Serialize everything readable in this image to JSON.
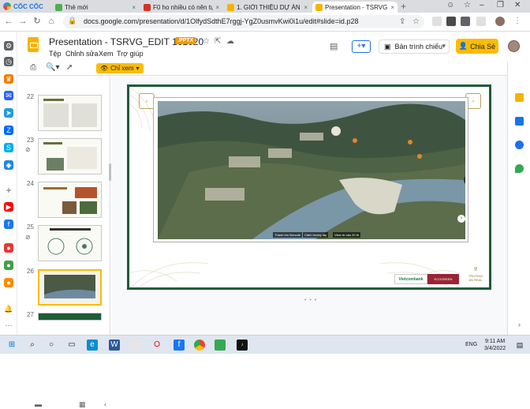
{
  "browser": {
    "name": "CỐC CỐC",
    "tabs": [
      {
        "label": "Thẻ mới",
        "fav_color": "#4caf50"
      },
      {
        "label": "F0 ho nhiều có nên tự",
        "fav_color": "#d93025"
      },
      {
        "label": "1. GIỚI THIỆU DỰ ÁN",
        "fav_color": "#f4b400"
      },
      {
        "label": "Presentation - TSRVG",
        "fav_color": "#f4b400"
      }
    ],
    "new_tab": "+",
    "url": "docs.google.com/presentation/d/1OlfydSdthE7rggj-YgZ0usmvKwi0i1u/edit#slide=id.p28"
  },
  "doc": {
    "title": "Presentation - TSRVG_EDIT 161020",
    "badge": ".PPTX",
    "menus": [
      "Tệp",
      "Chỉnh sửa",
      "Xem",
      "Trợ giúp"
    ],
    "present_label": "Bản trình chiếu",
    "share_label": "Chia Sẻ",
    "view_mode": "Chỉ xem"
  },
  "thumbnails": [
    {
      "num": "22"
    },
    {
      "num": "23"
    },
    {
      "num": "24"
    },
    {
      "num": "25"
    },
    {
      "num": "26",
      "selected": true
    },
    {
      "num": "27"
    }
  ],
  "slide": {
    "captions": [
      "Thành lớn Bonode",
      "Cảnh tượng tây",
      "View từ cầu 20 th"
    ],
    "bank": "Vietcombank",
    "partner": "ECOGREEN",
    "brand": "TRƯỜNG AN REAL"
  },
  "taskbar": {
    "lang": "ENG",
    "time": "9:11 AM",
    "date": "3/4/2022"
  },
  "colors": {
    "accent": "#fbbc04",
    "frame": "#1e5c3a",
    "link": "#1a73e8"
  }
}
